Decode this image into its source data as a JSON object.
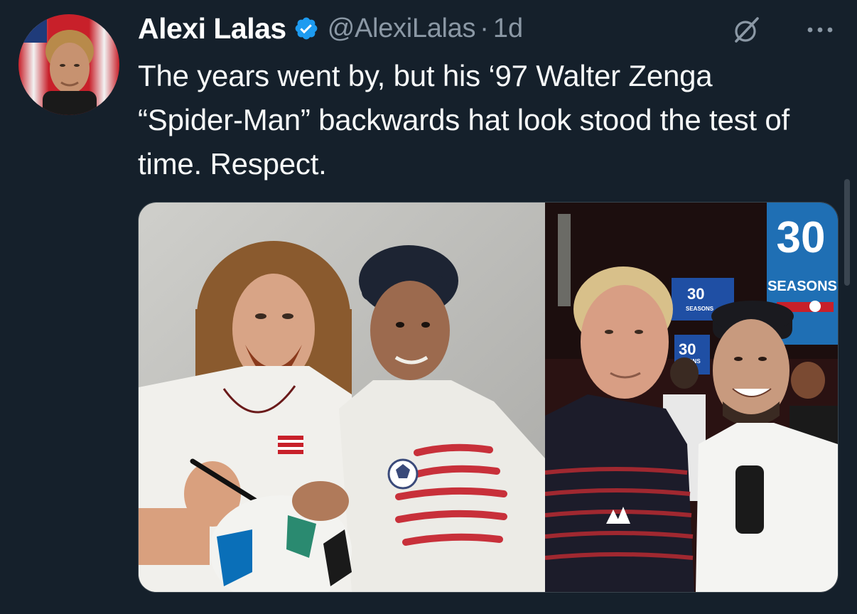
{
  "tweet": {
    "display_name": "Alexi Lalas",
    "handle": "@AlexiLalas",
    "separator": "·",
    "time": "1d",
    "text": "The years went by, but his ‘97 Walter Zenga “Spider-Man” backwards hat look stood the test of time. Respect.",
    "verified": true
  },
  "icons": {
    "verified": "verified-badge-icon",
    "grok": "grok-icon",
    "more": "more-options-icon"
  },
  "media": {
    "left_photo_description_hidden": "",
    "right_banner_main": "30",
    "right_banner_sub": "SEASONS",
    "screen_label_1": "30",
    "screen_label_1_sub": "SEASONS",
    "screen_label_2": "30",
    "screen_label_2_sub": "SONS"
  },
  "colors": {
    "background": "#15202b",
    "text_primary": "#f7f9f9",
    "text_secondary": "#8b98a5",
    "verified_blue": "#1d9bf0",
    "banner_blue": "#1f6fb4"
  }
}
